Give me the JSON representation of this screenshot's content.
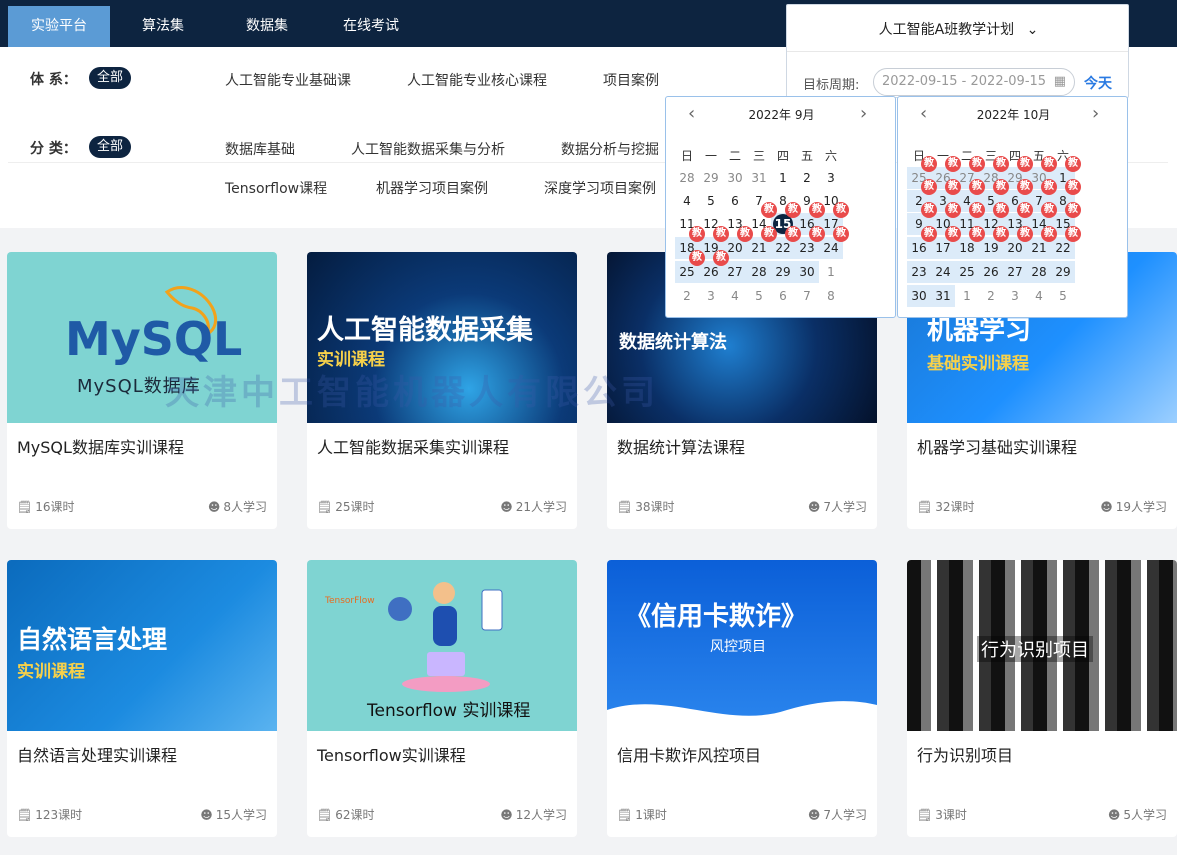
{
  "nav": {
    "tabs": [
      {
        "label": "实验平台",
        "active": true
      },
      {
        "label": "算法集",
        "active": false
      },
      {
        "label": "数据集",
        "active": false
      },
      {
        "label": "在线考试",
        "active": false
      }
    ]
  },
  "filters": {
    "system": {
      "label": "体 系：",
      "all": "全部",
      "items": [
        "人工智能专业基础课",
        "人工智能专业核心课程",
        "项目案例"
      ]
    },
    "category": {
      "label": "分 类：",
      "all": "全部",
      "items": [
        "数据库基础",
        "人工智能数据采集与分析",
        "数据分析与挖掘",
        "Tensorflow课程",
        "机器学习项目案例",
        "深度学习项目案例"
      ]
    }
  },
  "plan": {
    "title": "人工智能A班教学计划",
    "period_label": "目标周期:",
    "period_value": "2022-09-15 - 2022-09-15",
    "today": "今天"
  },
  "calendar": {
    "weekdays": [
      "日",
      "一",
      "二",
      "三",
      "四",
      "五",
      "六"
    ],
    "badge": "教",
    "left": {
      "title": "2022年 9月",
      "rows": [
        [
          "28",
          "29",
          "30",
          "31",
          "1",
          "2",
          "3"
        ],
        [
          "4",
          "5",
          "6",
          "7",
          "8",
          "9",
          "10"
        ],
        [
          "11",
          "12",
          "13",
          "14",
          "15",
          "16",
          "17"
        ],
        [
          "18",
          "19",
          "20",
          "21",
          "22",
          "23",
          "24"
        ],
        [
          "25",
          "26",
          "27",
          "28",
          "29",
          "30",
          "1"
        ],
        [
          "2",
          "3",
          "4",
          "5",
          "6",
          "7",
          "8"
        ]
      ]
    },
    "right": {
      "title": "2022年 10月",
      "rows": [
        [
          "25",
          "26",
          "27",
          "28",
          "29",
          "30",
          "1"
        ],
        [
          "2",
          "3",
          "4",
          "5",
          "6",
          "7",
          "8"
        ],
        [
          "9",
          "10",
          "11",
          "12",
          "13",
          "14",
          "15"
        ],
        [
          "16",
          "17",
          "18",
          "19",
          "20",
          "21",
          "22"
        ],
        [
          "23",
          "24",
          "25",
          "26",
          "27",
          "28",
          "29"
        ],
        [
          "30",
          "31",
          "1",
          "2",
          "3",
          "4",
          "5"
        ]
      ]
    }
  },
  "watermark": "天津中工智能机器人有限公司",
  "courses": [
    {
      "title": "MySQL数据库实训课程",
      "hours": "16课时",
      "learners": "8人学习",
      "cover_big": "MySQL",
      "cover_sub": "MySQL数据库"
    },
    {
      "title": "人工智能数据采集实训课程",
      "hours": "25课时",
      "learners": "21人学习",
      "cover_big": "人工智能数据采集",
      "cover_sub": "实训课程"
    },
    {
      "title": "数据统计算法课程",
      "hours": "38课时",
      "learners": "7人学习",
      "cover_big": "数据统计算法",
      "cover_sub": ""
    },
    {
      "title": "机器学习基础实训课程",
      "hours": "32课时",
      "learners": "19人学习",
      "cover_big": "机器学习",
      "cover_sub": "基础实训课程"
    },
    {
      "title": "自然语言处理实训课程",
      "hours": "123课时",
      "learners": "15人学习",
      "cover_big": "自然语言处理",
      "cover_sub": "实训课程"
    },
    {
      "title": "Tensorflow实训课程",
      "hours": "62课时",
      "learners": "12人学习",
      "cover_big": "Tensorflow 实训课程",
      "cover_sub": "TensorFlow"
    },
    {
      "title": "信用卡欺诈风控项目",
      "hours": "1课时",
      "learners": "7人学习",
      "cover_big": "《信用卡欺诈》",
      "cover_sub": "风控项目"
    },
    {
      "title": "行为识别项目",
      "hours": "3课时",
      "learners": "5人学习",
      "cover_big": "行为识别项目",
      "cover_sub": ""
    }
  ]
}
